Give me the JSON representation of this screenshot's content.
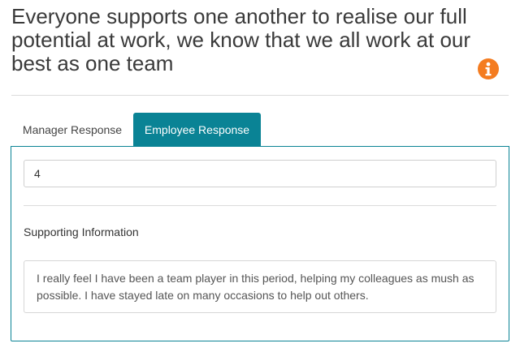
{
  "question": {
    "text": "Everyone supports one another to realise our full potential at work, we know that we all work at our best as one team",
    "info_icon": "info-icon",
    "info_icon_color": "#f47c20"
  },
  "tabs": [
    {
      "label": "Manager Response",
      "active": false
    },
    {
      "label": "Employee Response",
      "active": true
    }
  ],
  "accent_color": "#0a8395",
  "response": {
    "score_value": "4",
    "supporting_label": "Supporting Information",
    "supporting_text": "I really feel I have been a team player in this period, helping my colleagues as mush as possible. I have stayed late on many occasions to help out others."
  }
}
